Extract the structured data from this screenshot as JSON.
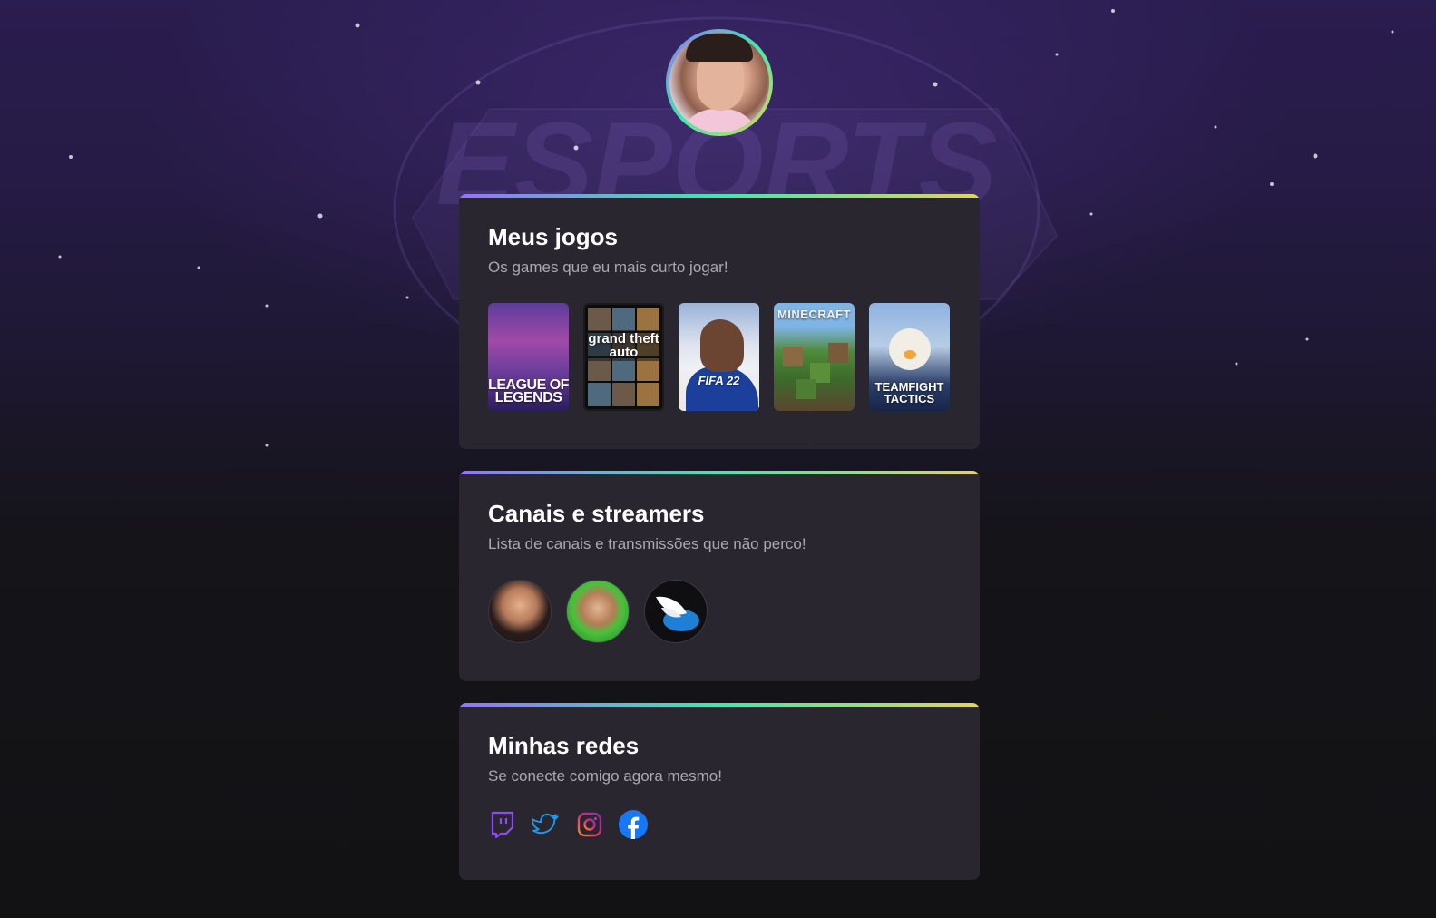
{
  "background": {
    "watermark_text": "ESPORTS"
  },
  "profile": {
    "avatar": "profile-photo"
  },
  "games_section": {
    "title": "Meus jogos",
    "subtitle": "Os games que eu mais curto jogar!",
    "games": [
      {
        "name": "League of Legends",
        "cover_text": "LEAGUE OF\nLEGENDS"
      },
      {
        "name": "Grand Theft Auto V",
        "cover_text": "grand theft auto"
      },
      {
        "name": "FIFA 22",
        "cover_text": "FIFA 22"
      },
      {
        "name": "Minecraft",
        "cover_text": "MINECRAFT"
      },
      {
        "name": "Teamfight Tactics",
        "cover_text": "TEAMFIGHT\nTACTICS"
      }
    ]
  },
  "streamers_section": {
    "title": "Canais e streamers",
    "subtitle": "Lista de canais e transmissões que não perco!",
    "streamers": [
      {
        "name": "streamer-1"
      },
      {
        "name": "streamer-2"
      },
      {
        "name": "streamer-3"
      }
    ]
  },
  "social_section": {
    "title": "Minhas redes",
    "subtitle": "Se conecte comigo agora mesmo!",
    "links": [
      {
        "network": "twitch",
        "icon": "twitch-icon",
        "color": "#9147ff"
      },
      {
        "network": "twitter",
        "icon": "twitter-icon",
        "color": "#1d9bf0"
      },
      {
        "network": "instagram",
        "icon": "instagram-icon",
        "color": "#e1306c"
      },
      {
        "network": "facebook",
        "icon": "facebook-icon",
        "color": "#1877f2"
      }
    ]
  },
  "colors": {
    "gradient_start": "#9572fc",
    "gradient_mid": "#43e7ad",
    "gradient_end": "#e2d45c",
    "card_bg": "#29262f",
    "page_bg": "#121214"
  }
}
